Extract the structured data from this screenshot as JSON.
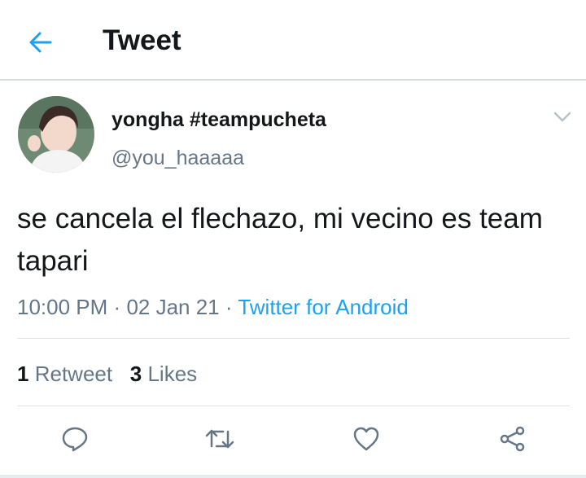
{
  "header": {
    "title": "Tweet"
  },
  "tweet": {
    "display_name": "yongha #teampucheta",
    "handle": "@you_haaaaa",
    "text": "se cancela el flechazo, mi vecino es team tapari",
    "time": "10:00 PM",
    "date": "02 Jan 21",
    "separator": "·",
    "source": "Twitter for Android"
  },
  "stats": {
    "retweets_count": "1",
    "retweets_label": "Retweet",
    "likes_count": "3",
    "likes_label": "Likes"
  },
  "actions": [
    "reply-icon",
    "retweet-icon",
    "like-icon",
    "share-icon"
  ],
  "colors": {
    "accent": "#1da1f2",
    "secondary_text": "#657786",
    "primary_text": "#14171a"
  }
}
